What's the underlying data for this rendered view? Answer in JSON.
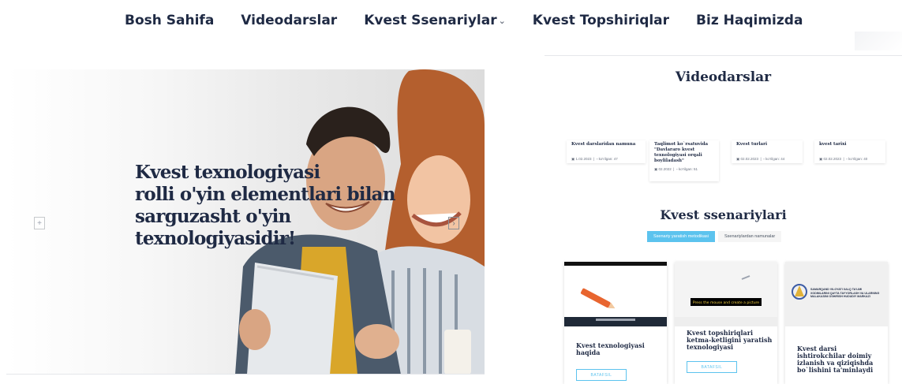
{
  "nav": {
    "items": [
      "Bosh Sahifa",
      "Videodarslar",
      "Kvest Ssenariylar",
      "Kvest Topshiriqlar",
      "Biz Haqimizda"
    ],
    "dropdown_icon": "chevron-down-icon"
  },
  "hero": {
    "lines": [
      "Kvest texnologiyasi",
      "rolli o'yin elementlari bilan",
      "sarguzasht o'yin",
      "texnologiyasidir!"
    ],
    "prev_icon": "+",
    "next_icon": "›"
  },
  "videodarslar": {
    "title": "Videodarslar",
    "cards": [
      {
        "title": "Kvest darslaridan namuna",
        "date": "1.02.2023",
        "views": "ko'rilgan: 47"
      },
      {
        "title": "Taqlimot ko`rsatuvida \"Davlararo kvest texnologiyasi orqali boyliladash\"",
        "date": "02.2022",
        "views": "ko'rilgan: 51"
      },
      {
        "title": "Kvest turlari",
        "date": "02.02.2023",
        "views": "ko'rilgan: 44"
      },
      {
        "title": "kvest tarixi",
        "date": "02.02.2023",
        "views": "ko'rilgan: 40"
      }
    ]
  },
  "ssenariylar": {
    "title": "Kvest ssenariylari",
    "tabs": [
      "Ssenariy yaratish metodikasi",
      "Ssenariylardan namunalar"
    ],
    "cards": [
      {
        "title": "Kvest texnologiyasi haqida",
        "button": "BATAFSIL"
      },
      {
        "title": "Kvest topshiriqlari ketma-ketligini yaratish texnologiyasi",
        "button": "BATAFSIL",
        "caption": "Press the mouse and create a picture"
      },
      {
        "title": "Kvest darsi ishtirokchilar doimiy izlanish va qiziqishda bo`lishini ta'minlaydi",
        "caption": "SAMARQAND VILOYATI XALQ TA'LIMI XODIMLARINI QAYTA TAYYORLASH VA ULARNING MALAKASINI OSHIRISH HUDUDIY MARKAZI"
      }
    ]
  },
  "colors": {
    "accent": "#5cc3ee",
    "heading": "#1f2a44"
  }
}
